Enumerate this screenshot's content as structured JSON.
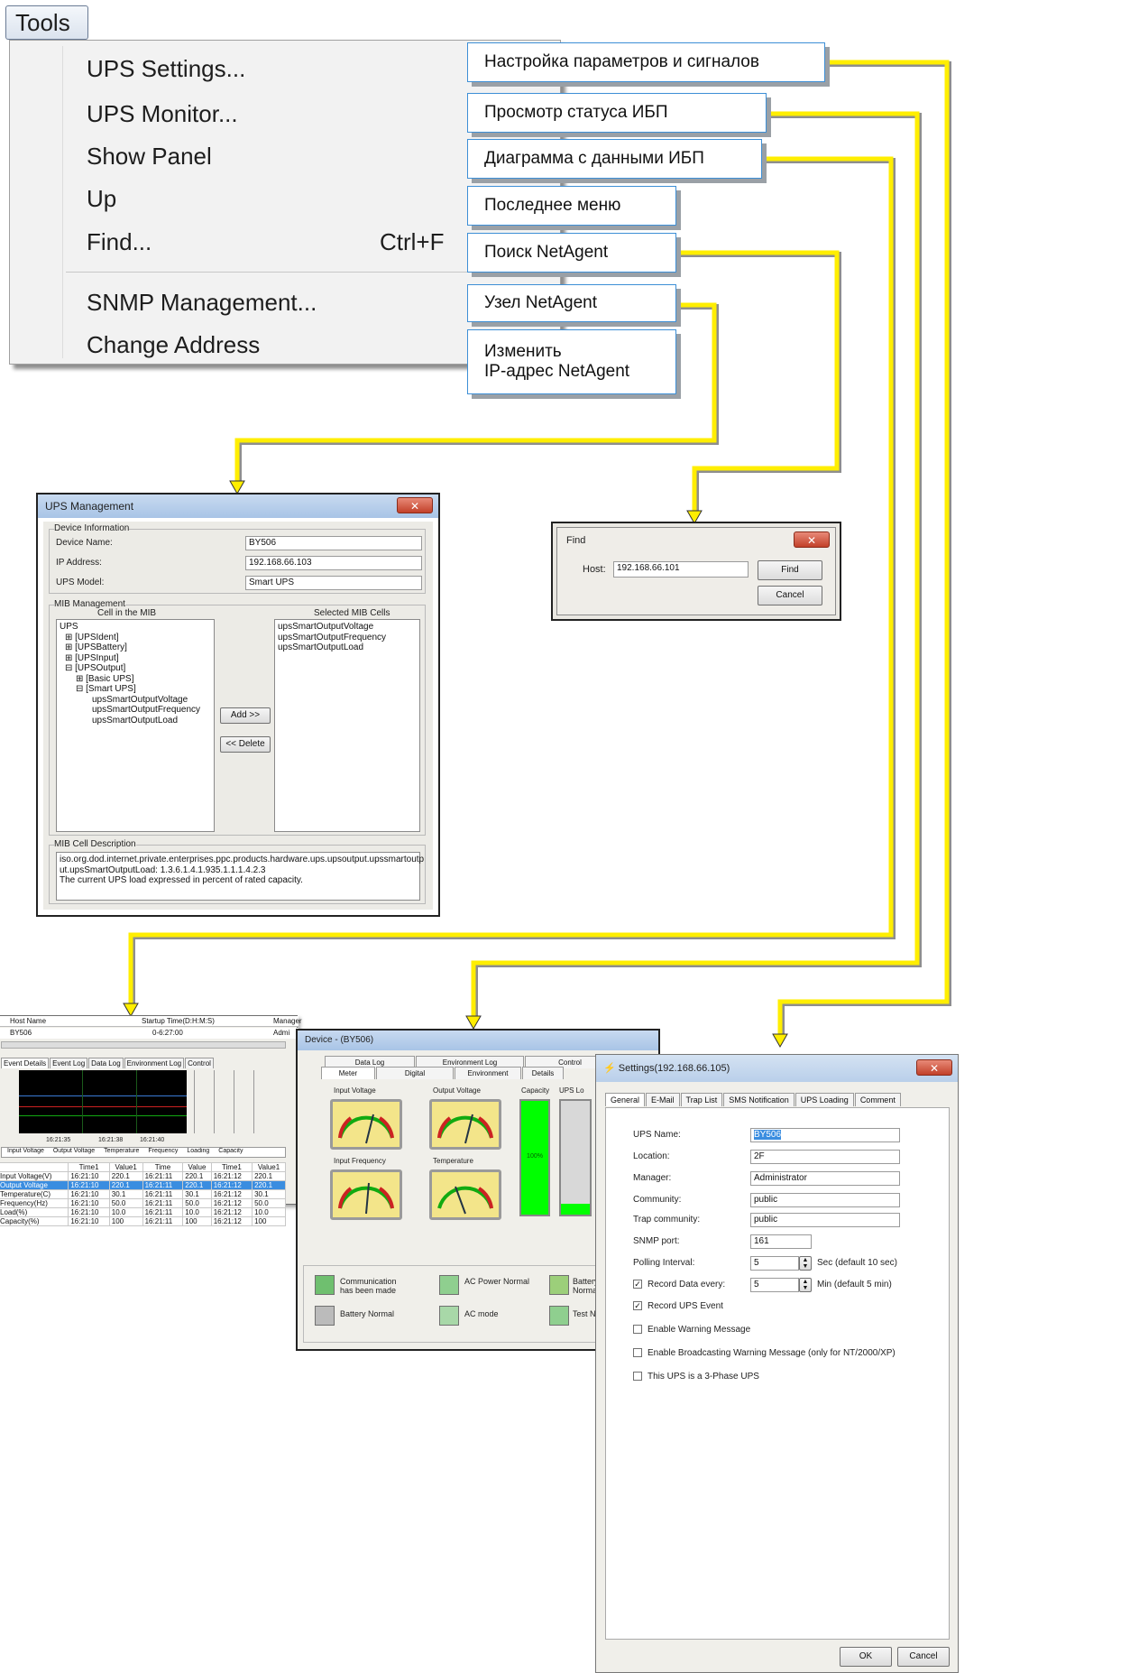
{
  "tools_menu": {
    "button_label": "Tools",
    "items": [
      {
        "label": "UPS Settings..."
      },
      {
        "label": "UPS Monitor..."
      },
      {
        "label": "Show Panel"
      },
      {
        "label": "Up"
      },
      {
        "label": "Find...",
        "shortcut": "Ctrl+F"
      },
      {
        "label": "SNMP Management..."
      },
      {
        "label": "Change Address"
      }
    ]
  },
  "callouts": [
    {
      "text": "Настройка параметров и сигналов"
    },
    {
      "text": "Просмотр статуса ИБП"
    },
    {
      "text": "Диаграмма с данными ИБП"
    },
    {
      "text": "Последнее меню"
    },
    {
      "text": "Поиск NetAgent"
    },
    {
      "text": "Узел NetAgent"
    },
    {
      "text": "Изменить\nIP-адрес NetAgent"
    }
  ],
  "connector_color": "#ffee00",
  "ups_management": {
    "title": "UPS Management",
    "device_info_group": "Device Information",
    "device_name_label": "Device Name:",
    "device_name_value": "BY506",
    "ip_label": "IP Address:",
    "ip_value": "192.168.66.103",
    "model_label": "UPS Model:",
    "model_value": "Smart UPS",
    "mib_group": "MIB Management",
    "cell_header": "Cell in the MIB",
    "selected_header": "Selected MIB Cells",
    "tree": [
      "UPS",
      "⊞ [UPSIdent]",
      "⊞ [UPSBattery]",
      "⊞ [UPSInput]",
      "⊟ [UPSOutput]",
      "⊞ [Basic UPS]",
      "⊟ [Smart UPS]",
      "upsSmartOutputVoltage",
      "upsSmartOutputFrequency",
      "upsSmartOutputLoad"
    ],
    "selected": [
      "upsSmartOutputVoltage",
      "upsSmartOutputFrequency",
      "upsSmartOutputLoad"
    ],
    "add_label": "Add >>",
    "delete_label": "<< Delete",
    "desc_group": "MIB Cell Description",
    "desc_lines": [
      "iso.org.dod.internet.private.enterprises.ppc.products.hardware.ups.upsoutput.upssmartoutp",
      "ut.upsSmartOutputLoad: 1.3.6.1.4.1.935.1.1.1.4.2.3",
      "The current UPS load expressed in percent of rated capacity."
    ]
  },
  "find_dialog": {
    "title": "Find",
    "host_label": "Host:",
    "host_value": "192.168.66.101",
    "find_label": "Find",
    "cancel_label": "Cancel"
  },
  "monitor_window": {
    "header_cols": [
      "Host Name",
      "Startup Time(D:H:M:S)",
      "Manager"
    ],
    "host_value": "BY506",
    "startup_value": "0-6:27:00",
    "manager_value": "Admi",
    "tabs": [
      "Event Details",
      "Event Log",
      "Data Log",
      "Environment Log",
      "Control"
    ],
    "x_ticks": [
      "16:21:35",
      "16:21:38",
      "16:21:40"
    ],
    "legend": [
      "Input Voltage",
      "Output Voltage",
      "Temperature",
      "Frequency",
      "Loading",
      "Capacity"
    ],
    "table_header": [
      "",
      "Time1",
      "Value1",
      "Time",
      "Value",
      "Time1",
      "Value1"
    ],
    "rows": [
      [
        "Input Voltage(V)",
        "16:21:10",
        "220.1",
        "16:21:11",
        "220.1",
        "16:21:12",
        "220.1"
      ],
      [
        "Output Voltage",
        "16:21:10",
        "220.1",
        "16:21:11",
        "220.1",
        "16:21:12",
        "220.1"
      ],
      [
        "Temperature(C)",
        "16:21:10",
        "30.1",
        "16:21:11",
        "30.1",
        "16:21:12",
        "30.1"
      ],
      [
        "Frequency(Hz)",
        "16:21:10",
        "50.0",
        "16:21:11",
        "50.0",
        "16:21:12",
        "50.0"
      ],
      [
        "Load(%)",
        "16:21:10",
        "10.0",
        "16:21:11",
        "10.0",
        "16:21:12",
        "10.0"
      ],
      [
        "Capacity(%)",
        "16:21:10",
        "100",
        "16:21:11",
        "100",
        "16:21:12",
        "100"
      ]
    ]
  },
  "device_window": {
    "title": "Device - (BY506)",
    "tabs_top": [
      "Data Log",
      "Environment Log",
      "Control"
    ],
    "tabs_bottom": [
      "Meter",
      "Digital",
      "Environment",
      "Details"
    ],
    "meter_labels": [
      "Input Voltage",
      "Output Voltage",
      "Capacity",
      "UPS Lo",
      "Input Frequency",
      "Temperature"
    ],
    "capacity_value": "100%",
    "status": [
      "Communication has been made",
      "AC Power Normal",
      "Battery Normal",
      "Battery Normal",
      "AC mode",
      "Test Nor"
    ]
  },
  "settings_dialog": {
    "title": "Settings(192.168.66.105)",
    "tabs": [
      "General",
      "E-Mail",
      "Trap List",
      "SMS Notification",
      "UPS Loading",
      "Comment"
    ],
    "fields": [
      {
        "label": "UPS Name:",
        "value": "BY506"
      },
      {
        "label": "Location:",
        "value": "2F"
      },
      {
        "label": "Manager:",
        "value": "Administrator"
      },
      {
        "label": "Community:",
        "value": "public"
      },
      {
        "label": "Trap community:",
        "value": "public"
      },
      {
        "label": "SNMP port:",
        "value": "161"
      }
    ],
    "polling_label": "Polling Interval:",
    "polling_value": "5",
    "polling_hint": "Sec (default 10 sec)",
    "record_data_label": "Record Data every:",
    "record_data_value": "5",
    "record_data_hint": "Min (default 5 min)",
    "record_event_label": "Record UPS Event",
    "warning_label": "Enable Warning Message",
    "broadcast_label": "Enable Broadcasting Warning Message (only for NT/2000/XP)",
    "three_phase_label": "This UPS is a 3-Phase UPS",
    "ok_label": "OK",
    "cancel_label": "Cancel"
  }
}
